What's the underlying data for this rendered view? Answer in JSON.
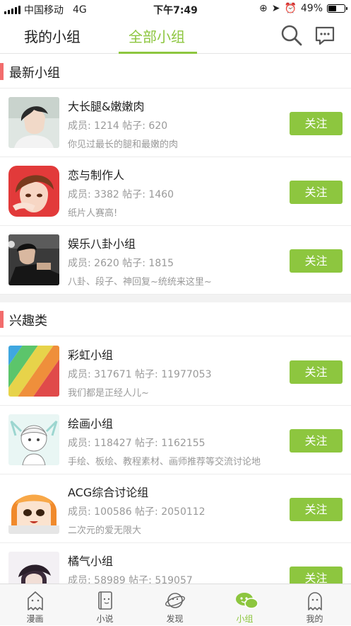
{
  "status": {
    "carrier": "中国移动",
    "network": "4G",
    "time": "下午7:49",
    "battery": "49%",
    "battery_level": 0.49
  },
  "nav": {
    "tabs": [
      "我的小组",
      "全部小组"
    ],
    "active_tab": 1,
    "accent": "#8dc63f"
  },
  "sections": [
    {
      "title": "最新小组",
      "groups": [
        {
          "name": "大长腿&嫩嫩肉",
          "stats": "成员: 1214  帖子: 620",
          "desc": "你见过最长的腿和最嫩的肉",
          "action": "关注"
        },
        {
          "name": "恋与制作人",
          "stats": "成员: 3382  帖子: 1460",
          "desc": "纸片人赛高!",
          "action": "关注"
        },
        {
          "name": "娱乐八卦小组",
          "stats": "成员: 2620  帖子: 1815",
          "desc": "八卦、段子、神回复~统统来这里~",
          "action": "关注"
        }
      ]
    },
    {
      "title": "兴趣类",
      "groups": [
        {
          "name": "彩虹小组",
          "stats": "成员: 317671  帖子: 11977053",
          "desc": "我们都是正经人儿~",
          "action": "关注"
        },
        {
          "name": "绘画小组",
          "stats": "成员: 118427  帖子: 1162155",
          "desc": "手绘、板绘、教程素材、画师推荐等交流讨论地",
          "action": "关注"
        },
        {
          "name": "ACG综合讨论组",
          "stats": "成员: 100586  帖子: 2050112",
          "desc": "二次元的爱无限大",
          "action": "关注"
        },
        {
          "name": "橘气小组",
          "stats": "成员: 58989  帖子: 519057",
          "desc": "",
          "action": "关注"
        }
      ]
    }
  ],
  "tabbar": {
    "items": [
      "漫画",
      "小说",
      "发现",
      "小组",
      "我的"
    ],
    "active": 3
  }
}
